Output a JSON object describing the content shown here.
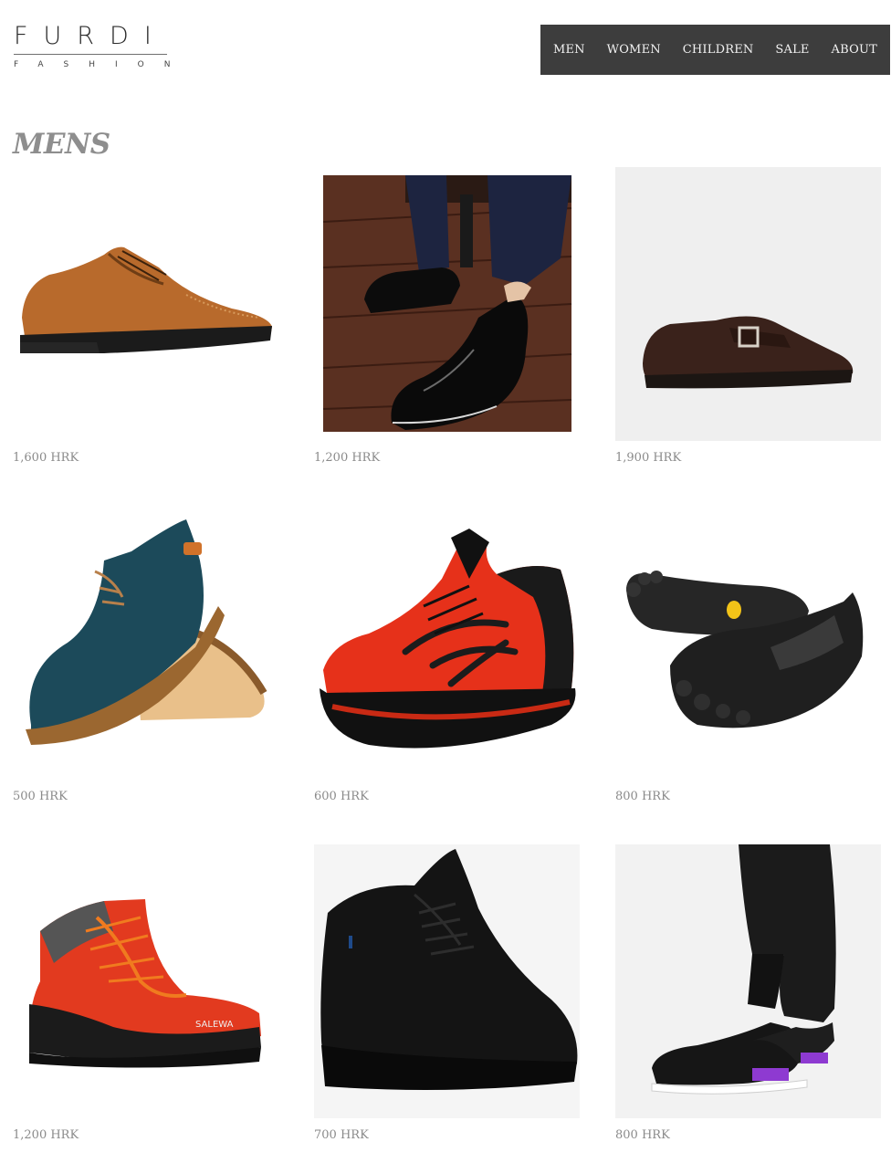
{
  "brand": {
    "name": "FURDI",
    "tagline": "FASHION"
  },
  "nav": {
    "items": [
      {
        "label": "MEN"
      },
      {
        "label": "WOMEN"
      },
      {
        "label": "CHILDREN"
      },
      {
        "label": "SALE"
      },
      {
        "label": "ABOUT"
      }
    ]
  },
  "page": {
    "title": "MENS"
  },
  "products": [
    {
      "price": "1,600 HRK",
      "image": "brown-brogue-shoe"
    },
    {
      "price": "1,200 HRK",
      "image": "black-leather-derby-on-feet"
    },
    {
      "price": "1,900 HRK",
      "image": "dark-brown-suede-monk-strap"
    },
    {
      "price": "500 HRK",
      "image": "teal-suede-oxford-pair"
    },
    {
      "price": "600 HRK",
      "image": "red-running-sneaker"
    },
    {
      "price": "800 HRK",
      "image": "black-toe-shoes-pair"
    },
    {
      "price": "1,200 HRK",
      "image": "red-hiking-boot"
    },
    {
      "price": "700 HRK",
      "image": "black-platform-sneaker"
    },
    {
      "price": "800 HRK",
      "image": "black-knit-sneaker-on-feet"
    }
  ],
  "colors": {
    "nav_bg": "#3d3d3d",
    "nav_text": "#f2f2f2",
    "title": "#8e8e8e",
    "price": "#8a8a8a"
  }
}
